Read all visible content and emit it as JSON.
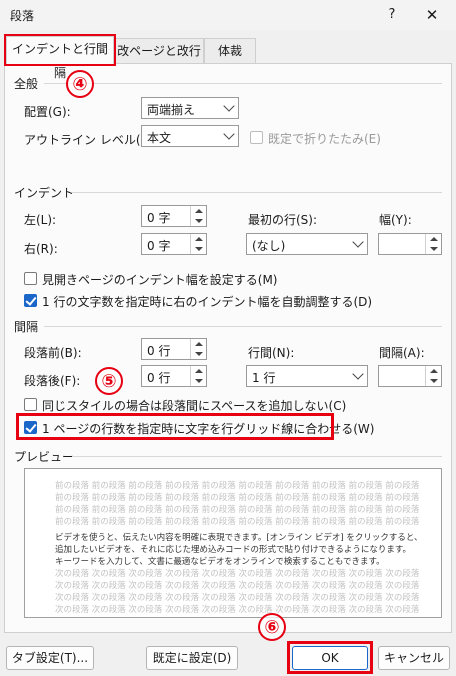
{
  "window": {
    "title": "段落",
    "help": "?",
    "close": "✕"
  },
  "tabs": [
    {
      "label": "インデントと行間隔"
    },
    {
      "label": "改ページと改行"
    },
    {
      "label": "体裁"
    }
  ],
  "general": {
    "heading": "全般",
    "alignment_label": "配置(G):",
    "alignment_value": "両端揃え",
    "outline_label": "アウトライン レベル(O):",
    "outline_value": "本文",
    "collapse_label": "既定で折りたたみ(E)"
  },
  "indent": {
    "heading": "インデント",
    "left_label": "左(L):",
    "left_value": "0 字",
    "right_label": "右(R):",
    "right_value": "0 字",
    "first_line_label": "最初の行(S):",
    "first_line_value": "(なし)",
    "width_label": "幅(Y):",
    "width_value": "",
    "mirror_label": "見開きページのインデント幅を設定する(M)",
    "auto_adjust_label": "1 行の文字数を指定時に右のインデント幅を自動調整する(D)"
  },
  "spacing": {
    "heading": "間隔",
    "before_label": "段落前(B):",
    "before_value": "0 行",
    "after_label": "段落後(F):",
    "after_value": "0 行",
    "line_spacing_label": "行間(N):",
    "line_spacing_value": "1 行",
    "at_label": "間隔(A):",
    "at_value": "",
    "no_space_label": "同じスタイルの場合は段落間にスペースを追加しない(C)",
    "snap_grid_label": "1 ページの行数を指定時に文字を行グリッド線に合わせる(W)"
  },
  "preview": {
    "heading": "プレビュー",
    "prev_lines": [
      "前の段落 前の段落 前の段落 前の段落 前の段落 前の段落 前の段落 前の段落 前の段落 前の段落",
      "前の段落 前の段落 前の段落 前の段落 前の段落 前の段落 前の段落 前の段落 前の段落 前の段落",
      "前の段落 前の段落 前の段落 前の段落 前の段落 前の段落 前の段落 前の段落 前の段落 前の段落",
      "前の段落 前の段落 前の段落 前の段落 前の段落 前の段落 前の段落 前の段落 前の段落 前の段落"
    ],
    "body_lines": [
      "ビデオを使うと、伝えたい内容を明確に表現できます。[オンライン ビデオ] をクリックすると、",
      "追加したいビデオを、それに応じた埋め込みコードの形式で貼り付けできるようになります。",
      "キーワードを入力して、文書に最適なビデオをオンラインで検索することもできます。"
    ],
    "next_lines": [
      "次の段落 次の段落 次の段落 次の段落 次の段落 次の段落 次の段落 次の段落 次の段落 次の段落",
      "次の段落 次の段落 次の段落 次の段落 次の段落 次の段落 次の段落 次の段落 次の段落 次の段落",
      "次の段落 次の段落 次の段落 次の段落 次の段落 次の段落 次の段落 次の段落 次の段落 次の段落",
      "次の段落 次の段落 次の段落 次の段落 次の段落 次の段落 次の段落 次の段落 次の段落 次の段落"
    ]
  },
  "buttons": {
    "tabs": "タブ設定(T)...",
    "set_default": "既定に設定(D)",
    "ok": "OK",
    "cancel": "キャンセル"
  },
  "annotations": {
    "step4": "④",
    "step5": "⑤",
    "step6": "⑥",
    "color": "#e60012"
  },
  "colors": {
    "checkbox": "#1a66c9",
    "highlight": "#e60012"
  }
}
